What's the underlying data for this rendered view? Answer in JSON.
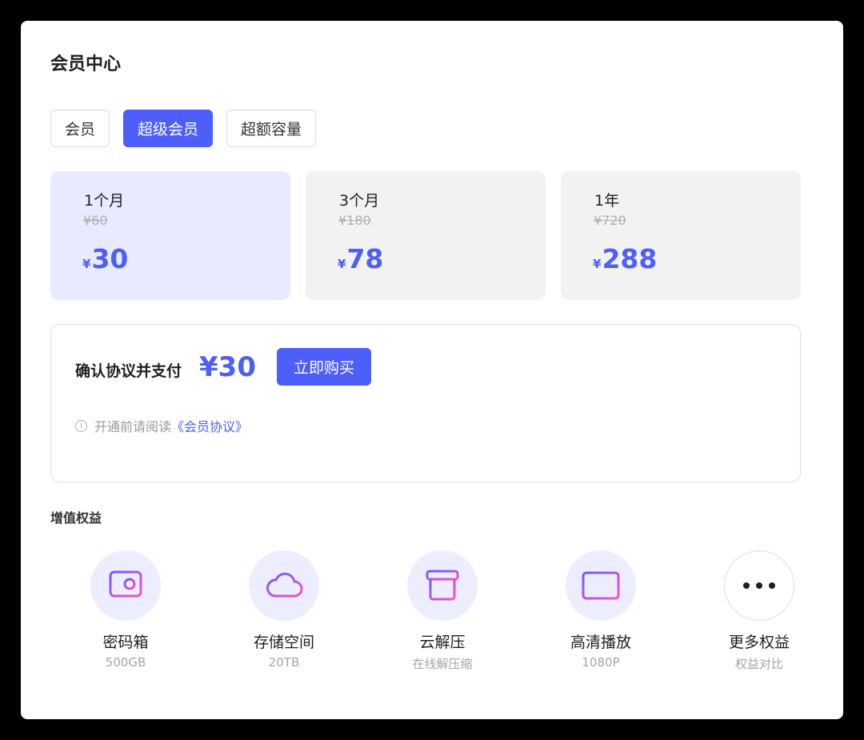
{
  "page": {
    "title": "会员中心"
  },
  "tabs": [
    {
      "label": "会员",
      "active": false
    },
    {
      "label": "超级会员",
      "active": true
    },
    {
      "label": "超额容量",
      "active": false
    }
  ],
  "plans": [
    {
      "name": "1个月",
      "original_price": "¥60",
      "currency": "¥",
      "price": "30",
      "selected": true
    },
    {
      "name": "3个月",
      "original_price": "¥180",
      "currency": "¥",
      "price": "78",
      "selected": false
    },
    {
      "name": "1年",
      "original_price": "¥720",
      "currency": "¥",
      "price": "288",
      "selected": false
    }
  ],
  "payment": {
    "label": "确认协议并支付",
    "amount": "¥30",
    "buy_label": "立即购买",
    "notice_prefix": "开通前请阅读",
    "agreement_link": "《会员协议》"
  },
  "benefits": {
    "title": "增值权益",
    "items": [
      {
        "name": "密码箱",
        "sub": "500GB",
        "icon": "safe-box-icon"
      },
      {
        "name": "存储空间",
        "sub": "20TB",
        "icon": "cloud-icon"
      },
      {
        "name": "云解压",
        "sub": "在线解压缩",
        "icon": "archive-box-icon"
      },
      {
        "name": "高清播放",
        "sub": "1080P",
        "icon": "video-card-icon"
      },
      {
        "name": "更多权益",
        "sub": "权益对比",
        "icon": "more-dots-icon"
      }
    ]
  },
  "colors": {
    "accent": "#4e5efb",
    "selected_plan_bg": "#e8eaff",
    "plan_bg": "#f2f2f3",
    "icon_gradient_start": "#6a5cff",
    "icon_gradient_end": "#ff4fc8"
  }
}
